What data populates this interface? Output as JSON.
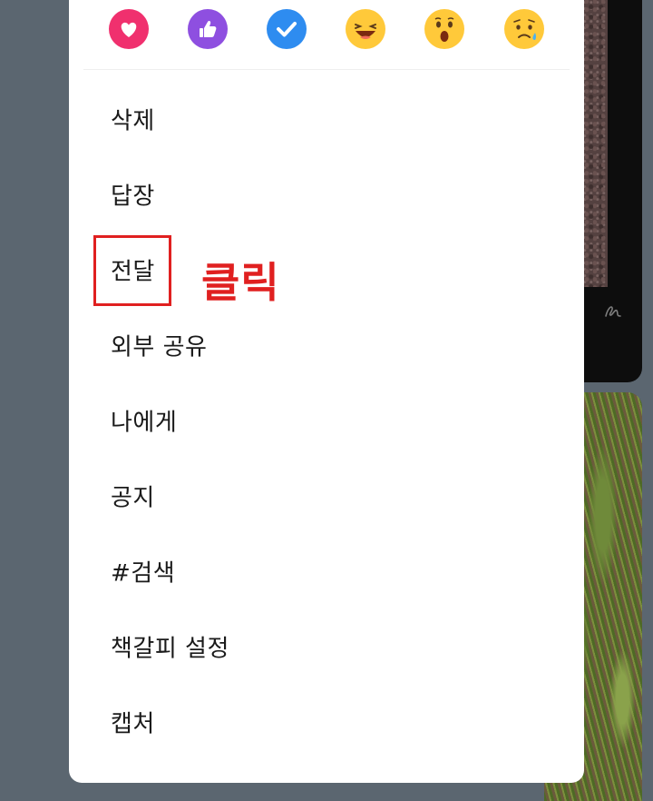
{
  "reactions": [
    {
      "name": "heart-reaction",
      "color": "#f0306e"
    },
    {
      "name": "thumbs-up-reaction",
      "color": "#8e4fe0"
    },
    {
      "name": "check-reaction",
      "color": "#2e8cf0"
    },
    {
      "name": "laughing-emoji",
      "color": "#ffc93a"
    },
    {
      "name": "surprised-emoji",
      "color": "#ffc93a"
    },
    {
      "name": "sad-emoji",
      "color": "#ffc93a"
    }
  ],
  "menu": {
    "items": [
      {
        "label": "삭제"
      },
      {
        "label": "답장"
      },
      {
        "label": "전달"
      },
      {
        "label": "외부 공유"
      },
      {
        "label": "나에게"
      },
      {
        "label": "공지"
      },
      {
        "label": "#검색"
      },
      {
        "label": "책갈피 설정"
      },
      {
        "label": "캡처"
      }
    ]
  },
  "annotation": {
    "text": "클릭",
    "color": "#e02020"
  }
}
